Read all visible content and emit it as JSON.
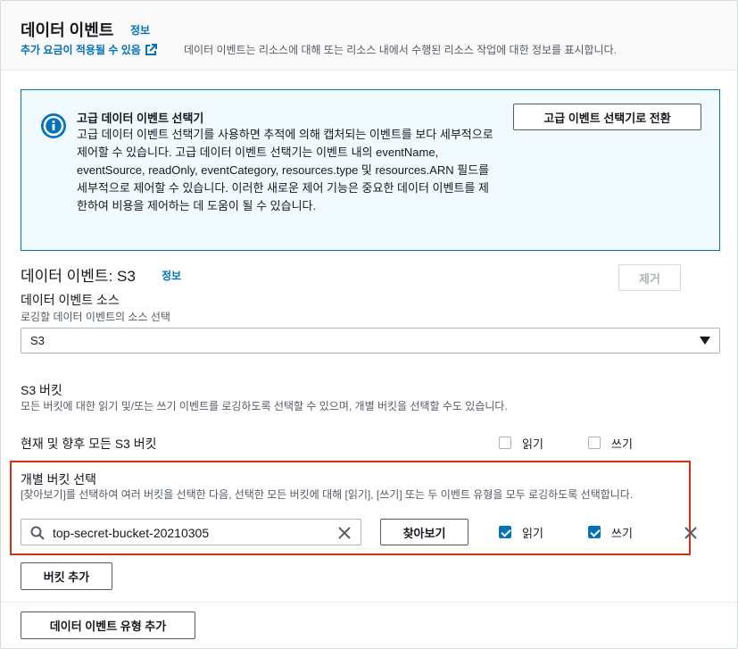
{
  "header": {
    "title": "데이터 이벤트",
    "info": "정보",
    "fee_link": "추가 요금이 적용될 수 있음",
    "description": "데이터 이벤트는 리소스에 대해 또는 리소스 내에서 수행된 리소스 작업에 대한 정보를 표시합니다."
  },
  "advanced_box": {
    "title": "고급 데이터 이벤트 선택기",
    "body": "고급 데이터 이벤트 선택기를 사용하면 추적에 의해 캡처되는 이벤트를 보다 세부적으로 제어할 수 있습니다. 고급 데이터 이벤트 선택기는 이벤트 내의 eventName, eventSource, readOnly, eventCategory, resources.type 및 resources.ARN 필드를 세부적으로 제어할 수 있습니다. 이러한 새로운 제어 기능은 중요한 데이터 이벤트를 제한하여 비용을 제어하는 데 도움이 될 수 있습니다.",
    "switch_button": "고급 이벤트 선택기로 전환",
    "icon": "info-icon"
  },
  "section": {
    "title": "데이터 이벤트: S3",
    "info": "정보",
    "remove_button": "제거"
  },
  "source": {
    "label": "데이터 이벤트 소스",
    "description": "로깅할 데이터 이벤트의 소스 선택",
    "selected": "S3"
  },
  "buckets": {
    "label": "S3 버킷",
    "description": "모든 버킷에 대한 읽기 및/또는 쓰기 이벤트를 로깅하도록 선택할 수 있으며, 개별 버킷을 선택할 수도 있습니다.",
    "all_label": "현재 및 향후 모든 S3 버킷",
    "all_read_label": "읽기",
    "all_write_label": "쓰기",
    "all_read_checked": false,
    "all_write_checked": false
  },
  "individual": {
    "label": "개별 버킷 선택",
    "description": "[찾아보기]를 선택하여 여러 버킷을 선택한 다음, 선택한 모든 버킷에 대해 [읽기], [쓰기] 또는 두 이벤트 유형을 모두 로깅하도록 선택합니다.",
    "search_value": "top-secret-bucket-20210305",
    "browse_button": "찾아보기",
    "read_label": "읽기",
    "write_label": "쓰기",
    "read_checked": true,
    "write_checked": true,
    "highlight_color": "#d13212"
  },
  "add_bucket_button": "버킷 추가",
  "add_event_type_button": "데이터 이벤트 유형 추가",
  "colors": {
    "link": "#0073bb",
    "info_bg": "#f1faff",
    "checkbox_checked": "#0073bb"
  }
}
